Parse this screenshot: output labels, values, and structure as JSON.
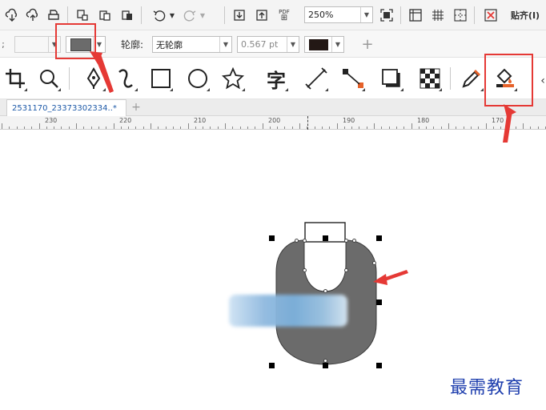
{
  "toolbar": {
    "icons": [
      "import-icon",
      "export-icon",
      "print-icon",
      "copy-icon",
      "paste-icon",
      "clipboard-icon",
      "undo-icon",
      "redo-icon",
      "import-down-icon",
      "export-up-icon",
      "pdf-icon",
      "fullscreen-icon",
      "rulers-icon",
      "grid-icon",
      "guidelines-icon",
      "snap-off-icon"
    ],
    "pdf_label": "PDF",
    "zoom_value": "250%",
    "snap_label": "贴齐(I)"
  },
  "properties": {
    "fill_color": "#6b6b6b",
    "outline_label": "轮廓:",
    "outline_style": "无轮廓",
    "outline_width": "0.567 pt",
    "outline_color": "#231815",
    "add_label": "+"
  },
  "tools": [
    "crop-tool",
    "zoom-tool",
    "pen-tool",
    "freehand-tool",
    "rectangle-tool",
    "ellipse-tool",
    "polygon-tool",
    "text-tool",
    "parallel-dimension-tool",
    "connector-tool",
    "drop-shadow-tool",
    "transparency-tool",
    "eyedropper-tool",
    "interactive-fill-tool"
  ],
  "text_tool_label": "字",
  "tabs": {
    "document": "2531170_23373302334..*",
    "add": "+"
  },
  "ruler": {
    "labels": [
      "230",
      "220",
      "210",
      "200",
      "190",
      "180",
      "170"
    ]
  },
  "canvas": {
    "shape_fill": "#6b6b6b",
    "watermark": "最需教育"
  },
  "colors": {
    "annotation_red": "#e53935",
    "accent": "#e6622a"
  }
}
